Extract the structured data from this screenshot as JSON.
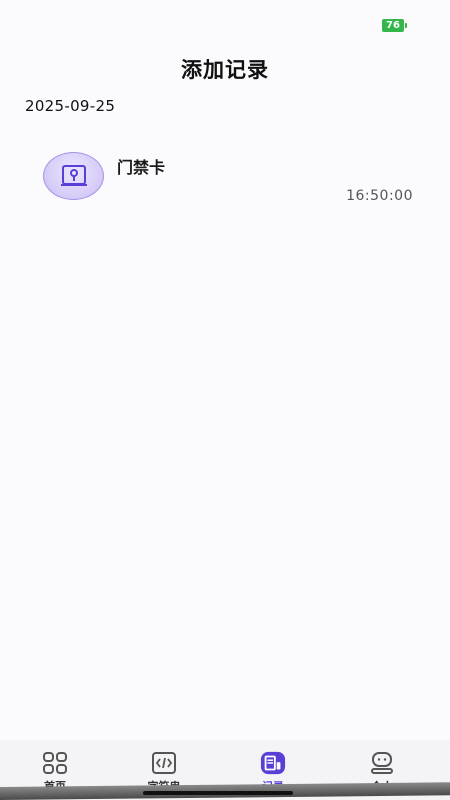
{
  "status_bar": {
    "battery": "76"
  },
  "header": {
    "title": "添加记录"
  },
  "date": "2025-09-25",
  "records": [
    {
      "name": "门禁卡",
      "time": "16:50:00",
      "icon": "door-lock-icon"
    }
  ],
  "tabs": [
    {
      "label": "首页",
      "icon": "grid-icon",
      "active": false
    },
    {
      "label": "字符串",
      "icon": "code-icon",
      "active": false
    },
    {
      "label": "记录",
      "icon": "record-icon",
      "active": true
    },
    {
      "label": "个人",
      "icon": "profile-icon",
      "active": false
    }
  ],
  "colors": {
    "accent": "#5a3fd6",
    "battery": "#35b64a"
  }
}
